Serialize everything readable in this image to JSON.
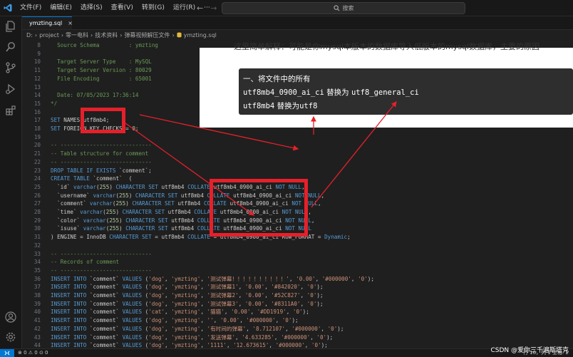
{
  "menu": [
    "文件(F)",
    "编辑(E)",
    "选择(S)",
    "查看(V)",
    "转到(G)",
    "运行(R)",
    "···"
  ],
  "search": {
    "placeholder": "搜索"
  },
  "tab": {
    "title": "ymzting.sql"
  },
  "breadcrumb": [
    "D:",
    "project",
    "零一电科",
    "技术资料",
    "弹幕视频解压文件",
    "ymzting.sql"
  ],
  "code_lines": [
    {
      "n": "8",
      "tokens": [
        {
          "t": "  Source Schema         : ymzting",
          "c": "c-cm"
        }
      ]
    },
    {
      "n": "9",
      "tokens": []
    },
    {
      "n": "10",
      "tokens": [
        {
          "t": "  Target Server Type    : MySQL",
          "c": "c-cm"
        }
      ]
    },
    {
      "n": "11",
      "tokens": [
        {
          "t": "  Target Server Version : 80029",
          "c": "c-cm"
        }
      ]
    },
    {
      "n": "12",
      "tokens": [
        {
          "t": "  File Encoding         : 65001",
          "c": "c-cm"
        }
      ]
    },
    {
      "n": "13",
      "tokens": []
    },
    {
      "n": "14",
      "tokens": [
        {
          "t": "  Date: 07/05/2023 17:36:14",
          "c": "c-cm"
        }
      ]
    },
    {
      "n": "15",
      "tokens": [
        {
          "t": "*/",
          "c": "c-cm"
        }
      ]
    },
    {
      "n": "16",
      "tokens": []
    },
    {
      "n": "17",
      "tokens": [
        {
          "t": "SET",
          "c": "c-kw"
        },
        {
          "t": " NAMES utf8mb4;",
          "c": "c-id"
        }
      ]
    },
    {
      "n": "18",
      "tokens": [
        {
          "t": "SET",
          "c": "c-kw"
        },
        {
          "t": " FOREIGN_KEY_CHECKS = ",
          "c": "c-id"
        },
        {
          "t": "0",
          "c": "c-num"
        },
        {
          "t": ";",
          "c": "c-id"
        }
      ]
    },
    {
      "n": "19",
      "tokens": []
    },
    {
      "n": "20",
      "tokens": [
        {
          "t": "-- ----------------------------",
          "c": "c-cm"
        }
      ]
    },
    {
      "n": "21",
      "tokens": [
        {
          "t": "-- Table structure for comment",
          "c": "c-cm"
        }
      ]
    },
    {
      "n": "22",
      "tokens": [
        {
          "t": "-- ----------------------------",
          "c": "c-cm"
        }
      ]
    },
    {
      "n": "23",
      "tokens": [
        {
          "t": "DROP TABLE IF EXISTS",
          "c": "c-kw"
        },
        {
          "t": " `comment`;",
          "c": "c-id"
        }
      ]
    },
    {
      "n": "24",
      "tokens": [
        {
          "t": "CREATE TABLE",
          "c": "c-kw"
        },
        {
          "t": " `comment`  (",
          "c": "c-id"
        }
      ]
    },
    {
      "n": "25",
      "tokens": [
        {
          "t": "  `id` ",
          "c": "c-id"
        },
        {
          "t": "varchar",
          "c": "c-kw"
        },
        {
          "t": "(",
          "c": "c-id"
        },
        {
          "t": "255",
          "c": "c-num"
        },
        {
          "t": ") ",
          "c": "c-id"
        },
        {
          "t": "CHARACTER SET",
          "c": "c-kw"
        },
        {
          "t": " utf8mb4 ",
          "c": "c-id"
        },
        {
          "t": "COLLATE",
          "c": "c-kw"
        },
        {
          "t": " utf8mb4_0900_ai_ci ",
          "c": "c-id"
        },
        {
          "t": "NOT NULL",
          "c": "c-kw"
        },
        {
          "t": ",",
          "c": "c-id"
        }
      ]
    },
    {
      "n": "26",
      "tokens": [
        {
          "t": "  `username` ",
          "c": "c-id"
        },
        {
          "t": "varchar",
          "c": "c-kw"
        },
        {
          "t": "(",
          "c": "c-id"
        },
        {
          "t": "255",
          "c": "c-num"
        },
        {
          "t": ") ",
          "c": "c-id"
        },
        {
          "t": "CHARACTER SET",
          "c": "c-kw"
        },
        {
          "t": " utf8mb4 ",
          "c": "c-id"
        },
        {
          "t": "COLLATE",
          "c": "c-kw"
        },
        {
          "t": " utf8mb4_0900_ai_ci ",
          "c": "c-id"
        },
        {
          "t": "NOT NULL",
          "c": "c-kw"
        },
        {
          "t": ",",
          "c": "c-id"
        }
      ]
    },
    {
      "n": "27",
      "tokens": [
        {
          "t": "  `comment` ",
          "c": "c-id"
        },
        {
          "t": "varchar",
          "c": "c-kw"
        },
        {
          "t": "(",
          "c": "c-id"
        },
        {
          "t": "255",
          "c": "c-num"
        },
        {
          "t": ") ",
          "c": "c-id"
        },
        {
          "t": "CHARACTER SET",
          "c": "c-kw"
        },
        {
          "t": " utf8mb4 ",
          "c": "c-id"
        },
        {
          "t": "COLLATE",
          "c": "c-kw"
        },
        {
          "t": " utf8mb4_0900_ai_ci ",
          "c": "c-id"
        },
        {
          "t": "NOT NULL",
          "c": "c-kw"
        },
        {
          "t": ",",
          "c": "c-id"
        }
      ]
    },
    {
      "n": "28",
      "tokens": [
        {
          "t": "  `time` ",
          "c": "c-id"
        },
        {
          "t": "varchar",
          "c": "c-kw"
        },
        {
          "t": "(",
          "c": "c-id"
        },
        {
          "t": "255",
          "c": "c-num"
        },
        {
          "t": ") ",
          "c": "c-id"
        },
        {
          "t": "CHARACTER SET",
          "c": "c-kw"
        },
        {
          "t": " utf8mb4 ",
          "c": "c-id"
        },
        {
          "t": "COLLATE",
          "c": "c-kw"
        },
        {
          "t": " utf8mb4_0900_ai_ci ",
          "c": "c-id"
        },
        {
          "t": "NOT NULL",
          "c": "c-kw"
        },
        {
          "t": ",",
          "c": "c-id"
        }
      ]
    },
    {
      "n": "29",
      "tokens": [
        {
          "t": "  `color` ",
          "c": "c-id"
        },
        {
          "t": "varchar",
          "c": "c-kw"
        },
        {
          "t": "(",
          "c": "c-id"
        },
        {
          "t": "255",
          "c": "c-num"
        },
        {
          "t": ") ",
          "c": "c-id"
        },
        {
          "t": "CHARACTER SET",
          "c": "c-kw"
        },
        {
          "t": " utf8mb4 ",
          "c": "c-id"
        },
        {
          "t": "COLLATE",
          "c": "c-kw"
        },
        {
          "t": " utf8mb4_0900_ai_ci ",
          "c": "c-id"
        },
        {
          "t": "NOT NULL",
          "c": "c-kw"
        },
        {
          "t": ",",
          "c": "c-id"
        }
      ]
    },
    {
      "n": "30",
      "tokens": [
        {
          "t": "  `isuse` ",
          "c": "c-id"
        },
        {
          "t": "varchar",
          "c": "c-kw"
        },
        {
          "t": "(",
          "c": "c-id"
        },
        {
          "t": "255",
          "c": "c-num"
        },
        {
          "t": ") ",
          "c": "c-id"
        },
        {
          "t": "CHARACTER SET",
          "c": "c-kw"
        },
        {
          "t": " utf8mb4 ",
          "c": "c-id"
        },
        {
          "t": "COLLATE",
          "c": "c-kw"
        },
        {
          "t": " utf8mb4_0900_ai_ci ",
          "c": "c-id"
        },
        {
          "t": "NOT NULL",
          "c": "c-kw"
        }
      ]
    },
    {
      "n": "31",
      "tokens": [
        {
          "t": ") ENGINE = InnoDB ",
          "c": "c-id"
        },
        {
          "t": "CHARACTER SET",
          "c": "c-kw"
        },
        {
          "t": " = utf8mb4 ",
          "c": "c-id"
        },
        {
          "t": "COLLATE",
          "c": "c-kw"
        },
        {
          "t": " = utf8mb4_0900_ai_ci ROW_FORMAT = ",
          "c": "c-id"
        },
        {
          "t": "Dynamic",
          "c": "c-kw"
        },
        {
          "t": ";",
          "c": "c-id"
        }
      ]
    },
    {
      "n": "32",
      "tokens": []
    },
    {
      "n": "33",
      "tokens": [
        {
          "t": "-- ----------------------------",
          "c": "c-cm"
        }
      ]
    },
    {
      "n": "34",
      "tokens": [
        {
          "t": "-- Records of comment",
          "c": "c-cm"
        }
      ]
    },
    {
      "n": "35",
      "tokens": [
        {
          "t": "-- ----------------------------",
          "c": "c-cm"
        }
      ]
    },
    {
      "n": "36",
      "tokens": [
        {
          "t": "INSERT INTO",
          "c": "c-kw"
        },
        {
          "t": " `comment` ",
          "c": "c-id"
        },
        {
          "t": "VALUES",
          "c": "c-kw"
        },
        {
          "t": " (",
          "c": "c-id"
        },
        {
          "t": "'dog'",
          "c": "c-str"
        },
        {
          "t": ", ",
          "c": "c-id"
        },
        {
          "t": "'ymzting'",
          "c": "c-str"
        },
        {
          "t": ", ",
          "c": "c-id"
        },
        {
          "t": "'测试弹幕！！！！！！！！！！'",
          "c": "c-str"
        },
        {
          "t": ", ",
          "c": "c-id"
        },
        {
          "t": "'0.00'",
          "c": "c-str"
        },
        {
          "t": ", ",
          "c": "c-id"
        },
        {
          "t": "'#000000'",
          "c": "c-str"
        },
        {
          "t": ", ",
          "c": "c-id"
        },
        {
          "t": "'0'",
          "c": "c-str"
        },
        {
          "t": ");",
          "c": "c-id"
        }
      ]
    },
    {
      "n": "37",
      "tokens": [
        {
          "t": "INSERT INTO",
          "c": "c-kw"
        },
        {
          "t": " `comment` ",
          "c": "c-id"
        },
        {
          "t": "VALUES",
          "c": "c-kw"
        },
        {
          "t": " (",
          "c": "c-id"
        },
        {
          "t": "'dog'",
          "c": "c-str"
        },
        {
          "t": ", ",
          "c": "c-id"
        },
        {
          "t": "'ymzting'",
          "c": "c-str"
        },
        {
          "t": ", ",
          "c": "c-id"
        },
        {
          "t": "'测试弹幕1'",
          "c": "c-str"
        },
        {
          "t": ", ",
          "c": "c-id"
        },
        {
          "t": "'0.00'",
          "c": "c-str"
        },
        {
          "t": ", ",
          "c": "c-id"
        },
        {
          "t": "'#842020'",
          "c": "c-str"
        },
        {
          "t": ", ",
          "c": "c-id"
        },
        {
          "t": "'0'",
          "c": "c-str"
        },
        {
          "t": ");",
          "c": "c-id"
        }
      ]
    },
    {
      "n": "38",
      "tokens": [
        {
          "t": "INSERT INTO",
          "c": "c-kw"
        },
        {
          "t": " `comment` ",
          "c": "c-id"
        },
        {
          "t": "VALUES",
          "c": "c-kw"
        },
        {
          "t": " (",
          "c": "c-id"
        },
        {
          "t": "'dog'",
          "c": "c-str"
        },
        {
          "t": ", ",
          "c": "c-id"
        },
        {
          "t": "'ymzting'",
          "c": "c-str"
        },
        {
          "t": ", ",
          "c": "c-id"
        },
        {
          "t": "'测试弹幕2'",
          "c": "c-str"
        },
        {
          "t": ", ",
          "c": "c-id"
        },
        {
          "t": "'0.00'",
          "c": "c-str"
        },
        {
          "t": ", ",
          "c": "c-id"
        },
        {
          "t": "'#52C827'",
          "c": "c-str"
        },
        {
          "t": ", ",
          "c": "c-id"
        },
        {
          "t": "'0'",
          "c": "c-str"
        },
        {
          "t": ");",
          "c": "c-id"
        }
      ]
    },
    {
      "n": "39",
      "tokens": [
        {
          "t": "INSERT INTO",
          "c": "c-kw"
        },
        {
          "t": " `comment` ",
          "c": "c-id"
        },
        {
          "t": "VALUES",
          "c": "c-kw"
        },
        {
          "t": " (",
          "c": "c-id"
        },
        {
          "t": "'dog'",
          "c": "c-str"
        },
        {
          "t": ", ",
          "c": "c-id"
        },
        {
          "t": "'ymzting'",
          "c": "c-str"
        },
        {
          "t": ", ",
          "c": "c-id"
        },
        {
          "t": "'测试弹幕3'",
          "c": "c-str"
        },
        {
          "t": ", ",
          "c": "c-id"
        },
        {
          "t": "'0.00'",
          "c": "c-str"
        },
        {
          "t": ", ",
          "c": "c-id"
        },
        {
          "t": "'#8311A0'",
          "c": "c-str"
        },
        {
          "t": ", ",
          "c": "c-id"
        },
        {
          "t": "'0'",
          "c": "c-str"
        },
        {
          "t": ");",
          "c": "c-id"
        }
      ]
    },
    {
      "n": "40",
      "tokens": [
        {
          "t": "INSERT INTO",
          "c": "c-kw"
        },
        {
          "t": " `comment` ",
          "c": "c-id"
        },
        {
          "t": "VALUES",
          "c": "c-kw"
        },
        {
          "t": " (",
          "c": "c-id"
        },
        {
          "t": "'cat'",
          "c": "c-str"
        },
        {
          "t": ", ",
          "c": "c-id"
        },
        {
          "t": "'ymzting'",
          "c": "c-str"
        },
        {
          "t": ", ",
          "c": "c-id"
        },
        {
          "t": "'猫猫'",
          "c": "c-str"
        },
        {
          "t": ", ",
          "c": "c-id"
        },
        {
          "t": "'0.00'",
          "c": "c-str"
        },
        {
          "t": ", ",
          "c": "c-id"
        },
        {
          "t": "'#DD1919'",
          "c": "c-str"
        },
        {
          "t": ", ",
          "c": "c-id"
        },
        {
          "t": "'0'",
          "c": "c-str"
        },
        {
          "t": ");",
          "c": "c-id"
        }
      ]
    },
    {
      "n": "41",
      "tokens": [
        {
          "t": "INSERT INTO",
          "c": "c-kw"
        },
        {
          "t": " `comment` ",
          "c": "c-id"
        },
        {
          "t": "VALUES",
          "c": "c-kw"
        },
        {
          "t": " (",
          "c": "c-id"
        },
        {
          "t": "'dog'",
          "c": "c-str"
        },
        {
          "t": ", ",
          "c": "c-id"
        },
        {
          "t": "'ymzting'",
          "c": "c-str"
        },
        {
          "t": ", ",
          "c": "c-id"
        },
        {
          "t": "''",
          "c": "c-str"
        },
        {
          "t": ", ",
          "c": "c-id"
        },
        {
          "t": "'0.00'",
          "c": "c-str"
        },
        {
          "t": ", ",
          "c": "c-id"
        },
        {
          "t": "'#000000'",
          "c": "c-str"
        },
        {
          "t": ", ",
          "c": "c-id"
        },
        {
          "t": "'0'",
          "c": "c-str"
        },
        {
          "t": ");",
          "c": "c-id"
        }
      ]
    },
    {
      "n": "42",
      "tokens": [
        {
          "t": "INSERT INTO",
          "c": "c-kw"
        },
        {
          "t": " `comment` ",
          "c": "c-id"
        },
        {
          "t": "VALUES",
          "c": "c-kw"
        },
        {
          "t": " (",
          "c": "c-id"
        },
        {
          "t": "'dog'",
          "c": "c-str"
        },
        {
          "t": ", ",
          "c": "c-id"
        },
        {
          "t": "'ymzting'",
          "c": "c-str"
        },
        {
          "t": ", ",
          "c": "c-id"
        },
        {
          "t": "'有时间的弹幕'",
          "c": "c-str"
        },
        {
          "t": ", ",
          "c": "c-id"
        },
        {
          "t": "'8.712107'",
          "c": "c-str"
        },
        {
          "t": ", ",
          "c": "c-id"
        },
        {
          "t": "'#000000'",
          "c": "c-str"
        },
        {
          "t": ", ",
          "c": "c-id"
        },
        {
          "t": "'0'",
          "c": "c-str"
        },
        {
          "t": ");",
          "c": "c-id"
        }
      ]
    },
    {
      "n": "43",
      "tokens": [
        {
          "t": "INSERT INTO",
          "c": "c-kw"
        },
        {
          "t": " `comment` ",
          "c": "c-id"
        },
        {
          "t": "VALUES",
          "c": "c-kw"
        },
        {
          "t": " (",
          "c": "c-id"
        },
        {
          "t": "'dog'",
          "c": "c-str"
        },
        {
          "t": ", ",
          "c": "c-id"
        },
        {
          "t": "'ymzting'",
          "c": "c-str"
        },
        {
          "t": ", ",
          "c": "c-id"
        },
        {
          "t": "'发送弹幕'",
          "c": "c-str"
        },
        {
          "t": ", ",
          "c": "c-id"
        },
        {
          "t": "'4.633285'",
          "c": "c-str"
        },
        {
          "t": ", ",
          "c": "c-id"
        },
        {
          "t": "'#000000'",
          "c": "c-str"
        },
        {
          "t": ", ",
          "c": "c-id"
        },
        {
          "t": "'0'",
          "c": "c-str"
        },
        {
          "t": ");",
          "c": "c-id"
        }
      ]
    },
    {
      "n": "44",
      "tokens": [
        {
          "t": "INSERT INTO",
          "c": "c-kw"
        },
        {
          "t": " `comment` ",
          "c": "c-id"
        },
        {
          "t": "VALUES",
          "c": "c-kw"
        },
        {
          "t": " (",
          "c": "c-id"
        },
        {
          "t": "'dog'",
          "c": "c-str"
        },
        {
          "t": ", ",
          "c": "c-id"
        },
        {
          "t": "'ymzting'",
          "c": "c-str"
        },
        {
          "t": ", ",
          "c": "c-id"
        },
        {
          "t": "'1111'",
          "c": "c-str"
        },
        {
          "t": ", ",
          "c": "c-id"
        },
        {
          "t": "'12.673615'",
          "c": "c-str"
        },
        {
          "t": ", ",
          "c": "c-id"
        },
        {
          "t": "'#000000'",
          "c": "c-str"
        },
        {
          "t": ", ",
          "c": "c-id"
        },
        {
          "t": "'0'",
          "c": "c-str"
        },
        {
          "t": ");",
          "c": "c-id"
        }
      ]
    }
  ],
  "overlay": {
    "top_text": "这里简单解释：可能是你mysql本版本的数据库导入低版本的mysql数据库，主要的原因",
    "note_heading": "一、将文件中的所有",
    "note_line1_a": "utf8mb4_0900_ai_ci",
    "note_line1_b": " 替换为 ",
    "note_line1_c": "utf8_general_ci",
    "note_line2_a": "utf8mb4",
    "note_line2_b": " 替换为",
    "note_line2_c": "utf8"
  },
  "status": {
    "left": "⊗ 0  ⚠ 0   ⊙ 0",
    "right": "行 16，列 1   空格: 2",
    "watermark": "CSDN @爱你三千遍斯塔克"
  },
  "colors": {
    "accent": "#0078d4",
    "highlight_red": "#e6202a"
  }
}
